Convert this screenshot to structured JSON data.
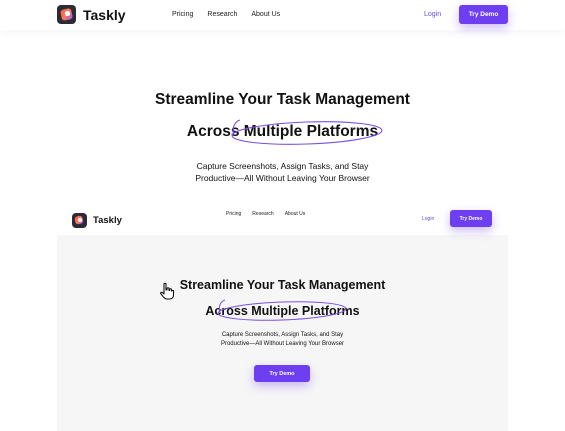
{
  "brand": {
    "name": "Taskly",
    "logo_icon": "taskly-logo-icon"
  },
  "nav": {
    "links": [
      "Pricing",
      "Research",
      "About Us"
    ],
    "login_label": "Login",
    "demo_label": "Try Demo"
  },
  "hero": {
    "line1": "Streamline Your Task Management",
    "line2": "Across Multiple Platforms",
    "subtitle_line1": "Capture Screenshots, Assign Tasks, and Stay",
    "subtitle_line2": "Productive—All Without Leaving Your Browser"
  },
  "preview": {
    "nav_links": [
      "Pricing",
      "Research",
      "About Us"
    ],
    "login_label": "Login",
    "demo_label": "Try Demo",
    "line1": "Streamline Your Task Management",
    "line2": "Across Multiple Platforms",
    "subtitle_line1": "Capture Screenshots, Assign Tasks, and Stay",
    "subtitle_line2": "Productive—All Without Leaving Your Browser",
    "cta_label": "Try Demo",
    "cursor_icon": "hand-pointer-icon"
  },
  "colors": {
    "accent": "#6d3ff0",
    "accent_text": "#6b4bdb",
    "oval_stroke": "#7a4fe0",
    "preview_bg": "#f6f6f6"
  }
}
